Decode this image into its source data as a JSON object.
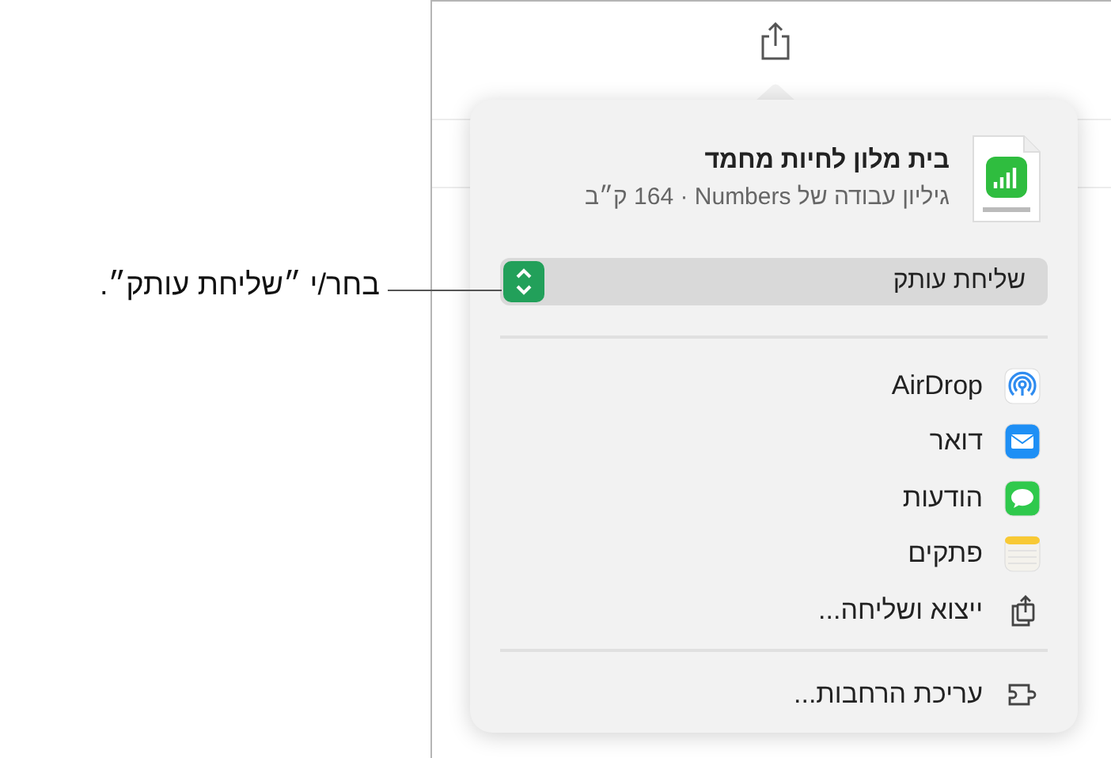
{
  "callout": {
    "text": "בחר/י ״שליחת עותק״."
  },
  "share_sheet": {
    "file": {
      "title": "בית מלון לחיות מחמד",
      "subtitle": "גיליון עבודה של Numbers‏ · 164 ק״ב"
    },
    "send_menu": {
      "value": "שליחת עותק"
    },
    "items": [
      {
        "label": "AirDrop"
      },
      {
        "label": "דואר"
      },
      {
        "label": "הודעות"
      },
      {
        "label": "פתקים"
      },
      {
        "label": "ייצוא ושליחה..."
      }
    ],
    "footer_item": {
      "label": "עריכת הרחבות..."
    }
  }
}
